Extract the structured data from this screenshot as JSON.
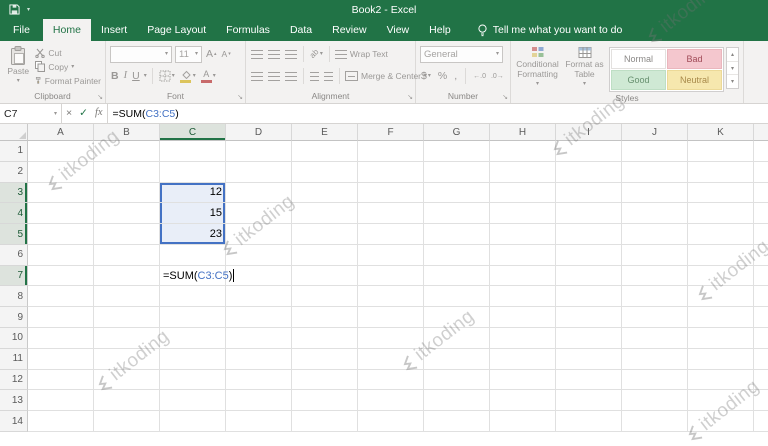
{
  "titlebar": {
    "title": "Book2 - Excel"
  },
  "tabs": [
    "File",
    "Home",
    "Insert",
    "Page Layout",
    "Formulas",
    "Data",
    "Review",
    "View",
    "Help"
  ],
  "active_tab": "Home",
  "tell_me": "Tell me what you want to do",
  "ribbon": {
    "clipboard": {
      "label": "Clipboard",
      "paste": "Paste",
      "cut": "Cut",
      "copy": "Copy",
      "format_painter": "Format Painter"
    },
    "font": {
      "label": "Font",
      "size": "11",
      "bold": "B",
      "italic": "I",
      "underline": "U",
      "grow_letter": "A",
      "shrink_letter": "A",
      "font_color_letter": "A"
    },
    "alignment": {
      "label": "Alignment",
      "wrap_text": "Wrap Text",
      "merge_center": "Merge & Center",
      "orientation": "ab"
    },
    "number": {
      "label": "Number",
      "format": "General",
      "currency": "$",
      "percent": "%",
      "comma": ",",
      "inc_decimal": "←.0",
      "dec_decimal": ".0→"
    },
    "styles": {
      "label": "Styles",
      "conditional": "Conditional Formatting",
      "format_table": "Format as Table",
      "cells": [
        "Normal",
        "Bad",
        "Good",
        "Neutral"
      ]
    }
  },
  "formula_bar": {
    "name_box": "C7",
    "fx_label": "fx",
    "parts": [
      {
        "text": "=SUM(",
        "color": "#000000"
      },
      {
        "text": "C3:C5",
        "color": "#4472c4"
      },
      {
        "text": ")",
        "color": "#000000"
      }
    ]
  },
  "grid": {
    "columns": [
      "A",
      "B",
      "C",
      "D",
      "E",
      "F",
      "G",
      "H",
      "I",
      "J",
      "K"
    ],
    "rows": [
      "1",
      "2",
      "3",
      "4",
      "5",
      "6",
      "7",
      "8",
      "9",
      "10",
      "11",
      "12",
      "13",
      "14"
    ],
    "highlight_columns": [
      "C"
    ],
    "highlight_rows": [
      "3",
      "4",
      "5",
      "7"
    ],
    "cells": {
      "C3": {
        "value": "12",
        "align": "right",
        "sel": "top"
      },
      "C4": {
        "value": "15",
        "align": "right",
        "sel": "mid"
      },
      "C5": {
        "value": "23",
        "align": "right",
        "sel": "bottom"
      },
      "C7": {
        "align": "left",
        "cursor": true,
        "parts": [
          {
            "text": "=SUM(",
            "color": "#000000"
          },
          {
            "text": "C3:C5",
            "color": "#4472c4"
          },
          {
            "text": ")",
            "color": "#000000"
          }
        ]
      }
    }
  },
  "icons": {
    "dropdown": "▾",
    "cancel": "×",
    "enter": "✓",
    "scroll_up": "▴",
    "scroll_down": "▾",
    "launcher": "↘"
  },
  "colors": {
    "excel_green": "#217346",
    "selection_blue": "#4472c4",
    "bad_bg": "#ffc7ce",
    "bad_text": "#9c0006",
    "good_bg": "#c6efce",
    "good_text": "#006100",
    "neutral_bg": "#ffeb9c",
    "neutral_text": "#9c6500"
  },
  "watermark": {
    "text": "itkoding"
  }
}
